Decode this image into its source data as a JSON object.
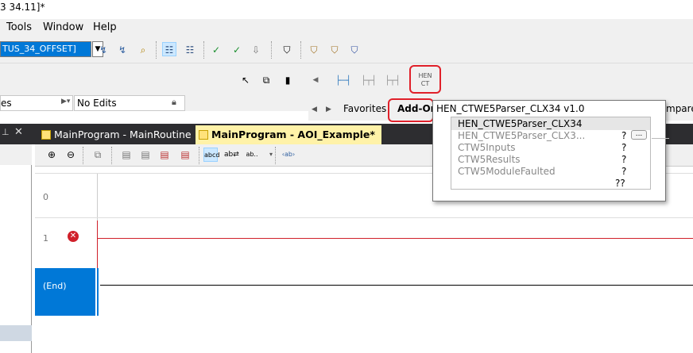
{
  "window": {
    "title_fragment": "3 34.11]*"
  },
  "menu": {
    "items": [
      "Tools",
      "Window",
      "Help"
    ]
  },
  "toolbar": {
    "combo_value": "TUS_34_OFFSET]"
  },
  "status": {
    "left_text": "es",
    "edit_status": "No Edits"
  },
  "categories": {
    "favorites": "Favorites",
    "addon": "Add-On",
    "compare_fragment": "mpare"
  },
  "hen_button": {
    "line1": "HEN",
    "line2": "CT"
  },
  "tabs": [
    {
      "label": "MainProgram - MainRoutine"
    },
    {
      "label": "MainProgram - AOI_Example*"
    }
  ],
  "ladder": {
    "rungs": [
      {
        "number": "0"
      },
      {
        "number": "1"
      }
    ],
    "end_label": "(End)"
  },
  "popup": {
    "title": "HEN_CTWE5Parser_CLX34 v1.0",
    "instruction": "HEN_CTWE5Parser_CLX34",
    "params": [
      {
        "name": "HEN_CTWE5Parser_CLX3...",
        "value": "?"
      },
      {
        "name": "CTW5Inputs",
        "value": "?"
      },
      {
        "name": "CTW5Results",
        "value": "?"
      },
      {
        "name": "CTW5ModuleFaulted",
        "value": "?"
      }
    ],
    "ellipsis": "...",
    "bottom": "??"
  },
  "colors": {
    "accent": "#0078d7",
    "highlight": "#e0202a",
    "tab_active": "#fff2a8"
  }
}
